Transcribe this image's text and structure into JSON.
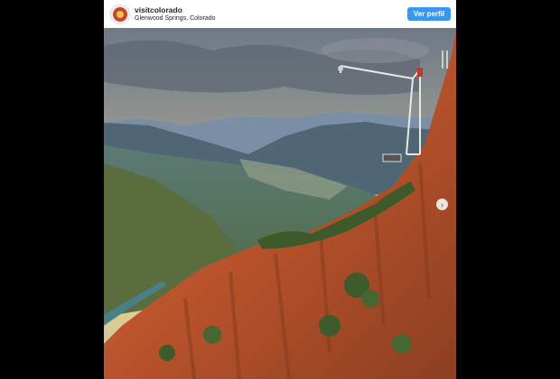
{
  "post": {
    "username": "visitcolorado",
    "location": "Glenwood Springs, Colorado",
    "follow_label": "Ver perfil"
  },
  "icons": {
    "avatar": "visitcolorado-logo",
    "next": "chevron-right-icon"
  },
  "colors": {
    "button": "#3897f0"
  }
}
